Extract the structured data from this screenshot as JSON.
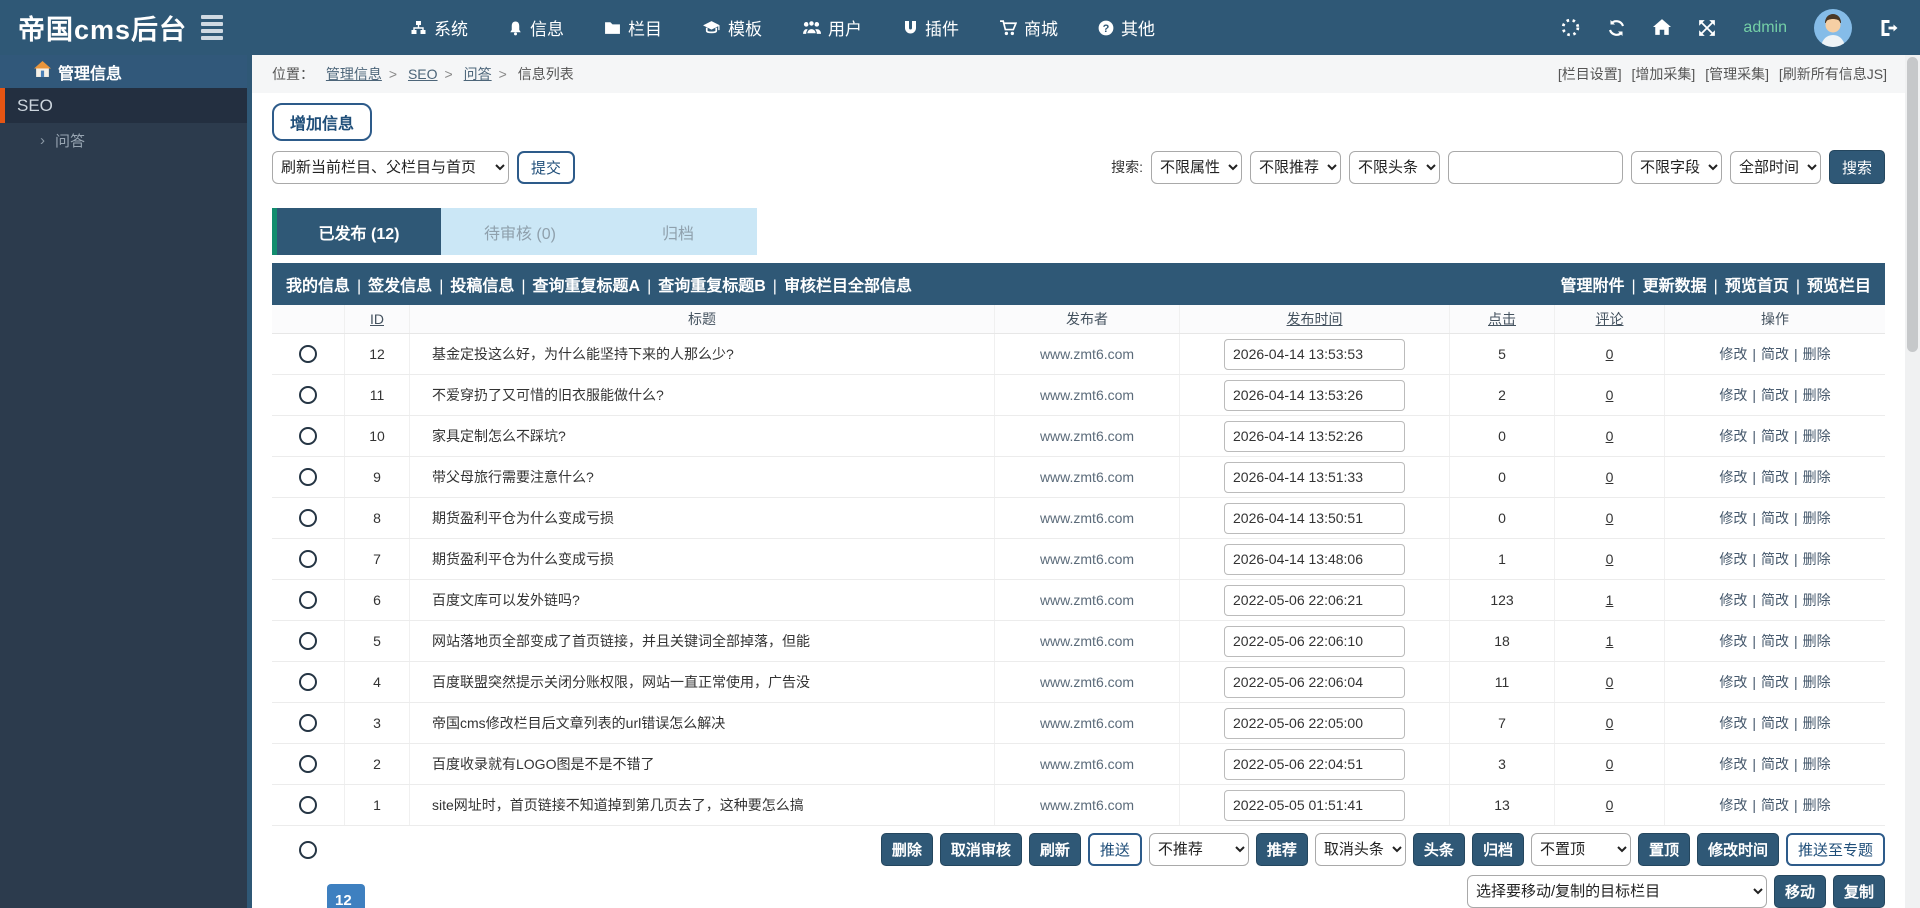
{
  "topbar": {
    "logo": "帝国cms后台",
    "nav": [
      "系统",
      "信息",
      "栏目",
      "模板",
      "用户",
      "插件",
      "商城",
      "其他"
    ],
    "username": "admin"
  },
  "sidebar": {
    "header": "管理信息",
    "group": "SEO",
    "item": "问答"
  },
  "breadcrumb": {
    "label": "位置：",
    "items": [
      "管理信息",
      "SEO",
      "问答",
      "信息列表"
    ],
    "right_links": [
      "[栏目设置]",
      "[增加采集]",
      "[管理采集]",
      "[刷新所有信息JS]"
    ]
  },
  "toolbar": {
    "add_label": "增加信息",
    "refresh_option": "刷新当前栏目、父栏目与首页",
    "submit_label": "提交"
  },
  "search": {
    "label": "搜索:",
    "attr_option": "不限属性",
    "recommend_option": "不限推荐",
    "headline_option": "不限头条",
    "input_value": "",
    "field_option": "不限字段",
    "time_option": "全部时间",
    "button_label": "搜索"
  },
  "tabs": [
    {
      "label": "已发布 (12)"
    },
    {
      "label": "待审核 (0)"
    },
    {
      "label": "归档"
    }
  ],
  "actionbar": {
    "left": [
      "我的信息",
      "签发信息",
      "投稿信息",
      "查询重复标题A",
      "查询重复标题B",
      "审核栏目全部信息"
    ],
    "right": [
      "管理附件",
      "更新数据",
      "预览首页",
      "预览栏目"
    ]
  },
  "table": {
    "headers": [
      "ID",
      "标题",
      "发布者",
      "发布时间",
      "点击",
      "评论",
      "操作"
    ],
    "ops": [
      "修改",
      "简改",
      "删除"
    ],
    "rows": [
      {
        "id": "12",
        "title": "基金定投这么好，为什么能坚持下来的人那么少?",
        "publisher": "www.zmt6.com",
        "time": "2026-04-14 13:53:53",
        "clicks": "5",
        "comments": "0"
      },
      {
        "id": "11",
        "title": "不爱穿扔了又可惜的旧衣服能做什么?",
        "publisher": "www.zmt6.com",
        "time": "2026-04-14 13:53:26",
        "clicks": "2",
        "comments": "0"
      },
      {
        "id": "10",
        "title": "家具定制怎么不踩坑?",
        "publisher": "www.zmt6.com",
        "time": "2026-04-14 13:52:26",
        "clicks": "0",
        "comments": "0"
      },
      {
        "id": "9",
        "title": "带父母旅行需要注意什么?",
        "publisher": "www.zmt6.com",
        "time": "2026-04-14 13:51:33",
        "clicks": "0",
        "comments": "0"
      },
      {
        "id": "8",
        "title": "期货盈利平仓为什么变成亏损",
        "publisher": "www.zmt6.com",
        "time": "2026-04-14 13:50:51",
        "clicks": "0",
        "comments": "0"
      },
      {
        "id": "7",
        "title": "期货盈利平仓为什么变成亏损",
        "publisher": "www.zmt6.com",
        "time": "2026-04-14 13:48:06",
        "clicks": "1",
        "comments": "0"
      },
      {
        "id": "6",
        "title": "百度文库可以发外链吗?",
        "publisher": "www.zmt6.com",
        "time": "2022-05-06 22:06:21",
        "clicks": "123",
        "comments": "1"
      },
      {
        "id": "5",
        "title": "网站落地页全部变成了首页链接，并且关键词全部掉落，但能",
        "publisher": "www.zmt6.com",
        "time": "2022-05-06 22:06:10",
        "clicks": "18",
        "comments": "1"
      },
      {
        "id": "4",
        "title": "百度联盟突然提示关闭分账权限，网站一直正常使用，广告没",
        "publisher": "www.zmt6.com",
        "time": "2022-05-06 22:06:04",
        "clicks": "11",
        "comments": "0"
      },
      {
        "id": "3",
        "title": "帝国cms修改栏目后文章列表的url错误怎么解决",
        "publisher": "www.zmt6.com",
        "time": "2022-05-06 22:05:00",
        "clicks": "7",
        "comments": "0"
      },
      {
        "id": "2",
        "title": "百度收录就有LOGO图是不是不错了",
        "publisher": "www.zmt6.com",
        "time": "2022-05-06 22:04:51",
        "clicks": "3",
        "comments": "0"
      },
      {
        "id": "1",
        "title": "site网址时，首页链接不知道掉到第几页去了，这种要怎么搞",
        "publisher": "www.zmt6.com",
        "time": "2022-05-05 01:51:41",
        "clicks": "13",
        "comments": "0"
      }
    ]
  },
  "footer": {
    "delete": "删除",
    "cancel_audit": "取消审核",
    "refresh": "刷新",
    "push": "推送",
    "no_recommend_option": "不推荐",
    "recommend": "推荐",
    "cancel_headline_option": "取消头条",
    "headline": "头条",
    "archive": "归档",
    "no_top_option": "不置顶",
    "top": "置顶",
    "modify_time": "修改时间",
    "push_topic": "推送至专题",
    "move_select_option": "选择要移动/复制的目标栏目",
    "move": "移动",
    "copy": "复制",
    "page": "12"
  }
}
